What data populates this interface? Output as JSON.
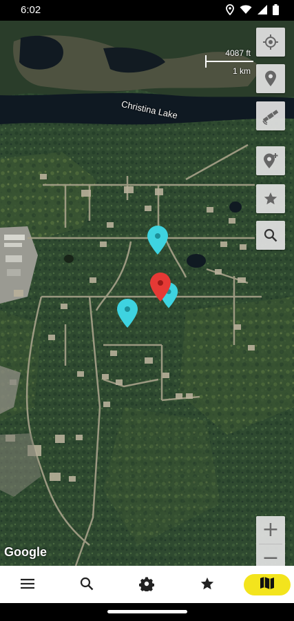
{
  "status_bar": {
    "time": "6:02",
    "icons": [
      "location-icon",
      "wifi-icon",
      "signal-icon",
      "battery-icon"
    ]
  },
  "map": {
    "lake_label": "Christina Lake",
    "attribution": "Google",
    "scale": {
      "top_label": "4087 ft",
      "bottom_label": "1 km"
    },
    "layer": "satellite"
  },
  "map_controls": {
    "buttons": [
      "my-location-icon",
      "place-pin-icon",
      "satellite-icon",
      "add-location-icon",
      "favorite-star-icon",
      "search-icon"
    ],
    "zoom_in": "+",
    "zoom_out": "−"
  },
  "markers": [
    {
      "color": "#3ed3e0",
      "kind": "pin"
    },
    {
      "color": "#e53935",
      "kind": "pin"
    },
    {
      "color": "#3ed3e0",
      "kind": "pin"
    },
    {
      "color": "#3ed3e0",
      "kind": "pin"
    }
  ],
  "bottom_nav": {
    "items": [
      "menu-icon",
      "search-icon",
      "settings-icon",
      "favorites-icon",
      "map-icon"
    ],
    "active": "map-icon",
    "active_color": "#f3e41d"
  },
  "colors": {
    "water": "#101a24",
    "forest": "#2e4a30",
    "accent": "#f3e41d",
    "marker_cyan": "#3ed3e0",
    "marker_red": "#e53935"
  }
}
